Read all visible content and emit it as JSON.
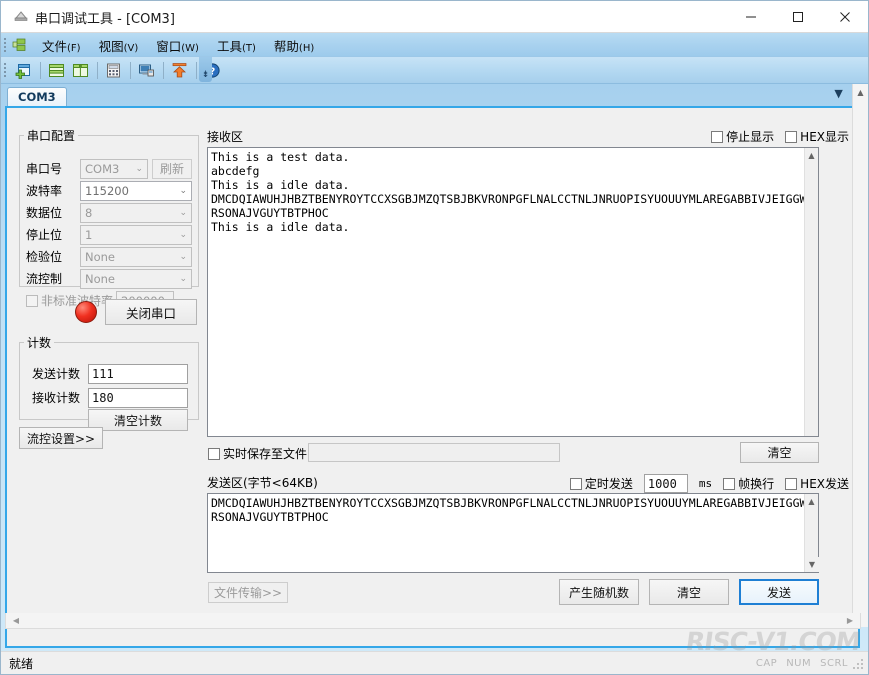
{
  "window": {
    "title": "串口调试工具 - [COM3]",
    "icon": "serial-tool-icon",
    "minimize": "–",
    "maximize": "□",
    "close": "✕"
  },
  "menubar": {
    "items": [
      {
        "label": "文件",
        "accel": "(F)"
      },
      {
        "label": "视图",
        "accel": "(V)"
      },
      {
        "label": "窗口",
        "accel": "(W)"
      },
      {
        "label": "工具",
        "accel": "(T)"
      },
      {
        "label": "帮助",
        "accel": "(H)"
      }
    ]
  },
  "toolbar": {
    "buttons": [
      {
        "name": "new-window-icon"
      },
      {
        "name": "tile-horizontal-icon"
      },
      {
        "name": "tile-vertical-icon"
      },
      {
        "name": "calculator-icon"
      },
      {
        "name": "monitor-icon"
      },
      {
        "name": "upload-icon"
      },
      {
        "name": "help-icon"
      }
    ],
    "overflow": "⇟"
  },
  "tabbar": {
    "tabs": [
      {
        "label": "COM3"
      }
    ],
    "dropdown": "▼",
    "close": "✕"
  },
  "child_window": {
    "minimize": "–",
    "restore": "❐",
    "close": "✕"
  },
  "serial_config": {
    "legend": "串口配置",
    "port_label": "串口号",
    "port_value": "COM3",
    "refresh_label": "刷新",
    "baud_label": "波特率",
    "baud_value": "115200",
    "databits_label": "数据位",
    "databits_value": "8",
    "stopbits_label": "停止位",
    "stopbits_value": "1",
    "parity_label": "检验位",
    "parity_value": "None",
    "flowctrl_label": "流控制",
    "flowctrl_value": "None",
    "custom_baud_label": "非标准波特率",
    "custom_baud_value": "200000",
    "custom_baud_checked": false
  },
  "connection": {
    "led_state": "connected-red",
    "close_port_label": "关闭串口"
  },
  "counters": {
    "legend": "计数",
    "tx_label": "发送计数",
    "tx_value": "111",
    "rx_label": "接收计数",
    "rx_value": "180",
    "clear_label": "清空计数"
  },
  "flow_settings": {
    "label": "流控设置>>"
  },
  "receive": {
    "title": "接收区",
    "stop_display_label": "停止显示",
    "stop_display_checked": false,
    "hex_display_label": "HEX显示",
    "hex_display_checked": false,
    "content": "This is a test data.\nabcdefg\nThis is a idle data.\nDMCDQIAWUHJHBZTBENYROYTCCXSGBJMZQTSBJBKVRONPGFLNALCCTNLJNRUOPISYUOUUYMLAREGABBIVJEIGGWORSONAJVGUYTBTPHOC\nThis is a idle data.",
    "save_to_file_label": "实时保存至文件",
    "save_to_file_checked": false,
    "save_path_value": "",
    "clear_label": "清空"
  },
  "send": {
    "title": "发送区(字节<64KB)",
    "timed_send_label": "定时发送",
    "timed_send_checked": false,
    "interval_value": "1000",
    "interval_unit": "ms",
    "frame_newline_label": "帧换行",
    "frame_newline_checked": false,
    "hex_send_label": "HEX发送",
    "hex_send_checked": false,
    "content": "DMCDQIAWUHJHBZTBENYROYTCCXSGBJMZQTSBJBKVRONPGFLNALCCTNLJNRUOPISYUOUUYMLAREGABBIVJEIGGWORSONAJVGUYTBTPHOC",
    "file_transfer_label": "文件传输>>",
    "random_label": "产生随机数",
    "clear_label": "清空",
    "send_label": "发送"
  },
  "statusbar": {
    "text": "就绪",
    "indicators": [
      "CAP",
      "NUM",
      "SCRL"
    ]
  },
  "watermark": "RISC-V1.COM",
  "scrollbars": {
    "up": "▲",
    "down": "▼",
    "left": "◀",
    "right": "▶"
  }
}
